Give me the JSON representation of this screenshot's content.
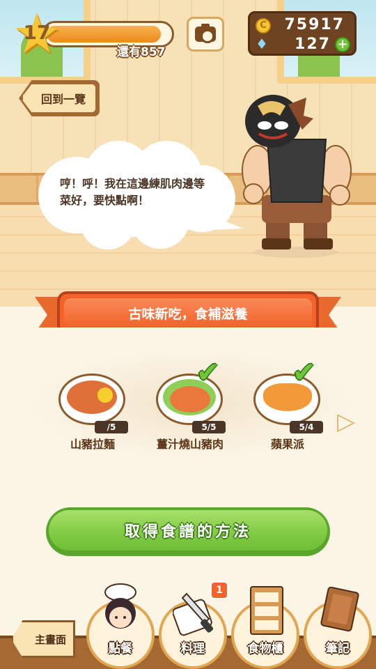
{
  "hud": {
    "level": "17",
    "exp_progress": 0.93,
    "exp_remaining_label": "還有857",
    "coins": "75917",
    "gems": "127",
    "coin_symbol": "C",
    "add_symbol": "+"
  },
  "navigation": {
    "back_label": "回到一覽",
    "home_label": "主畫面"
  },
  "customer": {
    "speech": "哼！呼！我在這邊練肌肉邊等菜好，要快點啊！"
  },
  "banner": {
    "title": "古味新吃，食補滋養"
  },
  "dishes": [
    {
      "name": "山豬拉麵",
      "count": "/5",
      "completed": false
    },
    {
      "name": "薑汁燒山豬肉",
      "count": "5/5",
      "completed": true
    },
    {
      "name": "蘋果派",
      "count": "5/4",
      "completed": true
    }
  ],
  "recipe_button_label": "取得食譜的方法",
  "bottom_nav": {
    "tabs": [
      {
        "label": "點餐",
        "icon": "chef-girl-icon"
      },
      {
        "label": "料理",
        "icon": "knife-board-icon",
        "badge": "1"
      },
      {
        "label": "食物櫃",
        "icon": "shelf-icon"
      },
      {
        "label": "筆記",
        "icon": "notebook-icon"
      }
    ]
  },
  "colors": {
    "accent_orange": "#f2622a",
    "accent_green": "#82cc46",
    "brown": "#8a5a2b"
  }
}
